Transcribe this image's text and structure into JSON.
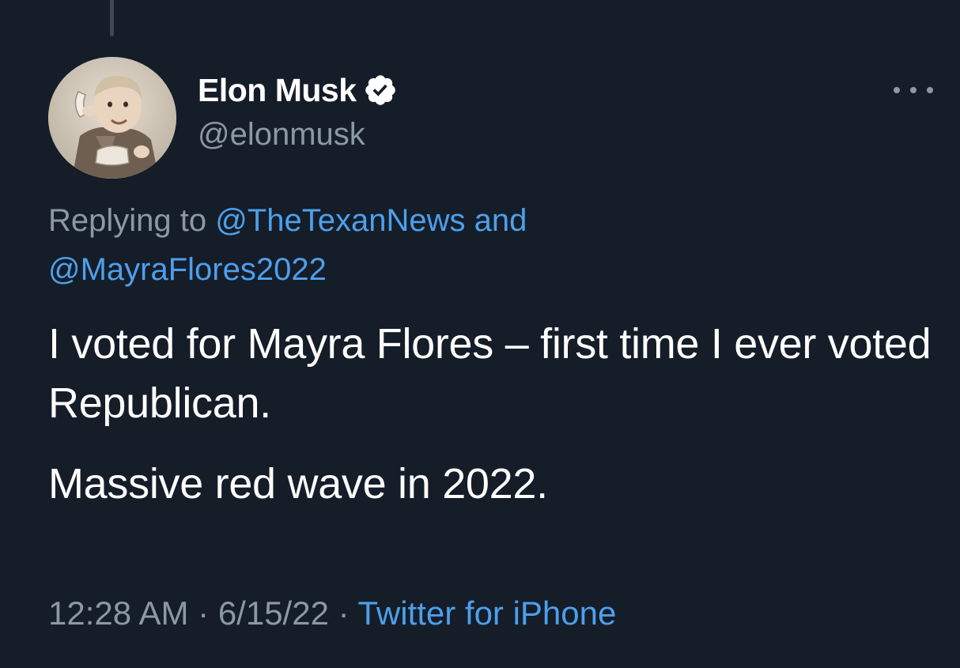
{
  "author": {
    "display_name": "Elon Musk",
    "handle": "@elonmusk",
    "verified": true
  },
  "reply": {
    "prefix": "Replying to",
    "mention_1": "@TheTexanNews",
    "conjunction": "and",
    "mention_2": "@MayraFlores2022"
  },
  "tweet": {
    "paragraphs": [
      "I voted for Mayra Flores – first time I ever voted Republican.",
      "Massive red wave in 2022."
    ]
  },
  "meta": {
    "time": "12:28 AM",
    "separator": "·",
    "date": "6/15/22",
    "source": "Twitter for iPhone"
  },
  "icons": {
    "verified": "verified-badge-icon",
    "more": "more-options-icon"
  },
  "colors": {
    "background": "#151d28",
    "text_primary": "#ffffff",
    "text_secondary": "#8b98a5",
    "link": "#4d9fec"
  }
}
